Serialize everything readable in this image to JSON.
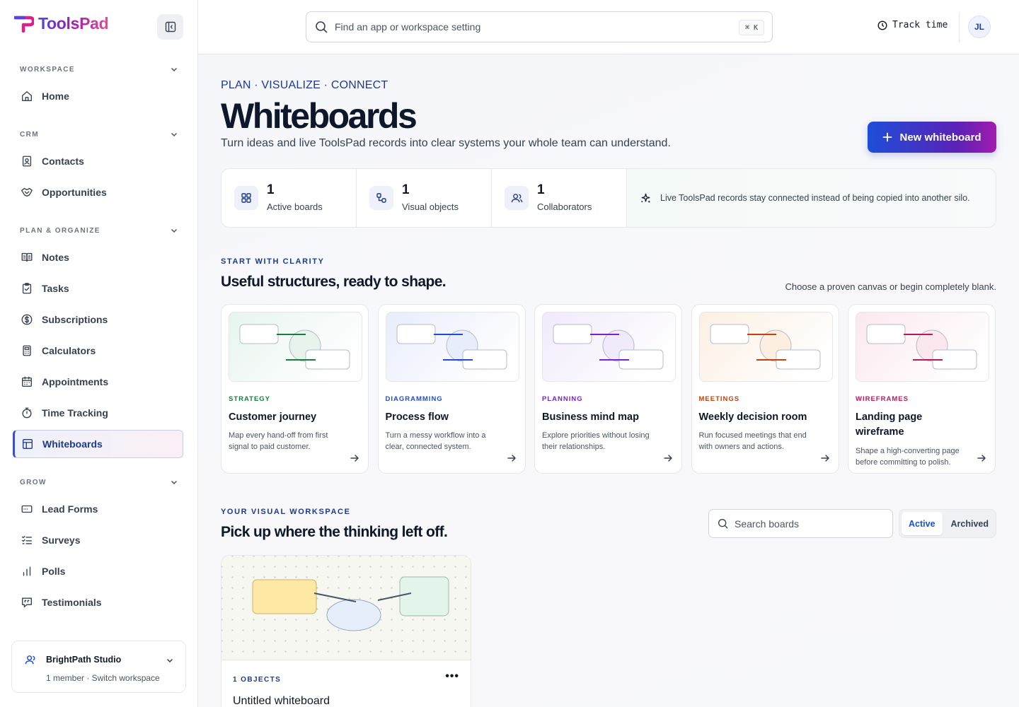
{
  "app": {
    "name": "ToolsPad"
  },
  "sidebar": {
    "sections": [
      {
        "title": "WORKSPACE",
        "items": [
          {
            "label": "Home",
            "icon": "home-icon"
          }
        ]
      },
      {
        "title": "CRM",
        "items": [
          {
            "label": "Contacts",
            "icon": "contacts-icon"
          },
          {
            "label": "Opportunities",
            "icon": "handshake-icon"
          }
        ]
      },
      {
        "title": "PLAN & ORGANIZE",
        "items": [
          {
            "label": "Notes",
            "icon": "book-icon"
          },
          {
            "label": "Tasks",
            "icon": "clipboard-check-icon"
          },
          {
            "label": "Subscriptions",
            "icon": "dollar-circle-icon"
          },
          {
            "label": "Calculators",
            "icon": "calculator-icon"
          },
          {
            "label": "Appointments",
            "icon": "calendar-icon"
          },
          {
            "label": "Time Tracking",
            "icon": "stopwatch-icon"
          },
          {
            "label": "Whiteboards",
            "icon": "layout-icon",
            "active": true
          }
        ]
      },
      {
        "title": "GROW",
        "items": [
          {
            "label": "Lead Forms",
            "icon": "form-icon"
          },
          {
            "label": "Surveys",
            "icon": "checklist-icon"
          },
          {
            "label": "Polls",
            "icon": "bar-chart-icon"
          },
          {
            "label": "Testimonials",
            "icon": "quote-icon"
          }
        ]
      }
    ],
    "workspace": {
      "name": "BrightPath Studio",
      "subtitle": "1 member · Switch workspace"
    }
  },
  "topbar": {
    "search_placeholder": "Find an app or workspace setting",
    "shortcut": "⌘ K",
    "track_time": "Track time",
    "avatar_initials": "JL"
  },
  "header": {
    "eyebrow": "PLAN · VISUALIZE · CONNECT",
    "title": "Whiteboards",
    "subtitle": "Turn ideas and live ToolsPad records into clear systems your whole team can understand.",
    "new_button": "New whiteboard"
  },
  "stats": [
    {
      "value": "1",
      "label": "Active boards",
      "icon": "grid-icon"
    },
    {
      "value": "1",
      "label": "Visual objects",
      "icon": "shapes-icon"
    },
    {
      "value": "1",
      "label": "Collaborators",
      "icon": "users-icon"
    }
  ],
  "stats_note": "Live ToolsPad records stay connected instead of being copied into another silo.",
  "templates_section": {
    "kicker": "START WITH CLARITY",
    "title": "Useful structures, ready to shape.",
    "aside": "Choose a proven canvas or begin completely blank."
  },
  "templates": [
    {
      "category": "STRATEGY",
      "name": "Customer journey",
      "description": "Map every hand-off from first signal to paid customer.",
      "color": "#15803d",
      "tint": "#e7f4ee"
    },
    {
      "category": "DIAGRAMMING",
      "name": "Process flow",
      "description": "Turn a messy workflow into a clear, connected system.",
      "color": "#1d4ed8",
      "tint": "#e8edfb"
    },
    {
      "category": "PLANNING",
      "name": "Business mind map",
      "description": "Explore priorities without losing their relationships.",
      "color": "#7e22ce",
      "tint": "#f0eafb"
    },
    {
      "category": "MEETINGS",
      "name": "Weekly decision room",
      "description": "Run focused meetings that end with owners and actions.",
      "color": "#c2410c",
      "tint": "#fcefe2"
    },
    {
      "category": "WIREFRAMES",
      "name": "Landing page wireframe",
      "description": "Shape a high-converting page before committing to polish.",
      "color": "#be185d",
      "tint": "#fbe8ef"
    }
  ],
  "boards_section": {
    "kicker": "YOUR VISUAL WORKSPACE",
    "title": "Pick up where the thinking left off.",
    "search_placeholder": "Search boards",
    "tabs": [
      {
        "label": "Active",
        "selected": true
      },
      {
        "label": "Archived",
        "selected": false
      }
    ]
  },
  "boards": [
    {
      "meta": "1 OBJECTS",
      "title": "Untitled whiteboard",
      "more": "•••"
    }
  ]
}
